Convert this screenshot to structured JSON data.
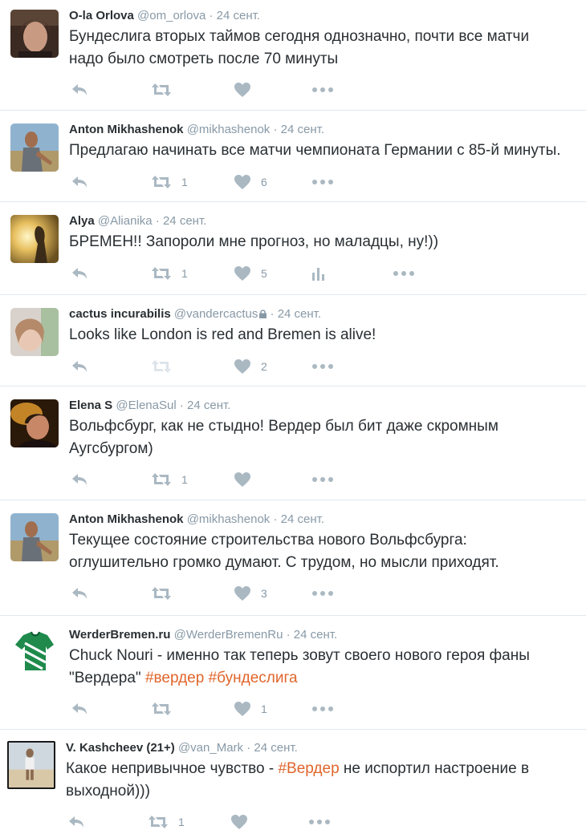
{
  "tweets": [
    {
      "name": "O-la Orlova",
      "handle": "@om_orlova",
      "sep": "·",
      "time": "24 сент.",
      "text_lines": [
        "Бундеслига вторых таймов сегодня однозначно, почти все матчи",
        "надо было смотреть после 70 минуты"
      ],
      "retweets": "",
      "likes": ""
    },
    {
      "name": "Anton Mikhashenok",
      "handle": "@mikhashenok",
      "sep": "·",
      "time": "24 сент.",
      "text_lines": [
        "Предлагаю начинать все матчи чемпионата Германии с 85-й минуты."
      ],
      "retweets": "1",
      "likes": "6"
    },
    {
      "name": "Alya",
      "handle": "@Alianika",
      "sep": "·",
      "time": "24 сент.",
      "text_lines": [
        "БРЕМЕН!! Запороли мне прогноз, но маладцы, ну!))"
      ],
      "retweets": "1",
      "likes": "5"
    },
    {
      "name": "cactus incurabilis",
      "handle": "@vandercactus",
      "sep": "·",
      "time": "24 сент.",
      "text_lines": [
        "Looks like London is red and Bremen is alive!"
      ],
      "retweets": "",
      "likes": "2"
    },
    {
      "name": "Elena S",
      "handle": "@ElenaSul",
      "sep": "·",
      "time": "24 сент.",
      "text_lines": [
        "Вольфсбург, как не стыдно! Вердер был бит даже скромным",
        "Аугсбургом)"
      ],
      "retweets": "1",
      "likes": ""
    },
    {
      "name": "Anton Mikhashenok",
      "handle": "@mikhashenok",
      "sep": "·",
      "time": "24 сент.",
      "text_lines": [
        "Текущее состояние строительства нового Вольфсбурга:",
        "оглушительно громко думают. С трудом, но мысли приходят."
      ],
      "retweets": "",
      "likes": "3"
    },
    {
      "name": "WerderBremen.ru",
      "handle": "@WerderBremenRu",
      "sep": "·",
      "time": "24 сент.",
      "text_lines": [
        "Chuck Nouri - именно так теперь зовут своего нового героя фаны"
      ],
      "text_line2_plain": "\"Вердера\" ",
      "hashtag_a": "#вердер",
      "text_space": " ",
      "hashtag_b": "#бундеслига",
      "retweets": "",
      "likes": "1"
    },
    {
      "name": "V. Kashcheev (21+)",
      "handle": "@van_Mark",
      "sep": "·",
      "time": "24 сент.",
      "text_line1_pre": "Какое непривычное чувство - ",
      "hashtag_a": "#Вердер",
      "text_line1_post": " не испортил настроение в",
      "text_lines": [
        "выходной)))"
      ],
      "retweets": "1",
      "likes": ""
    }
  ],
  "colors": {
    "hashtag": "#e0652b",
    "icon": "#aab8c2",
    "muted": "#8899a6",
    "text": "#292f33",
    "divider": "#e1e8ed"
  },
  "icons": [
    "reply-icon",
    "retweet-icon",
    "like-icon",
    "analytics-icon",
    "more-icon",
    "lock-icon"
  ]
}
